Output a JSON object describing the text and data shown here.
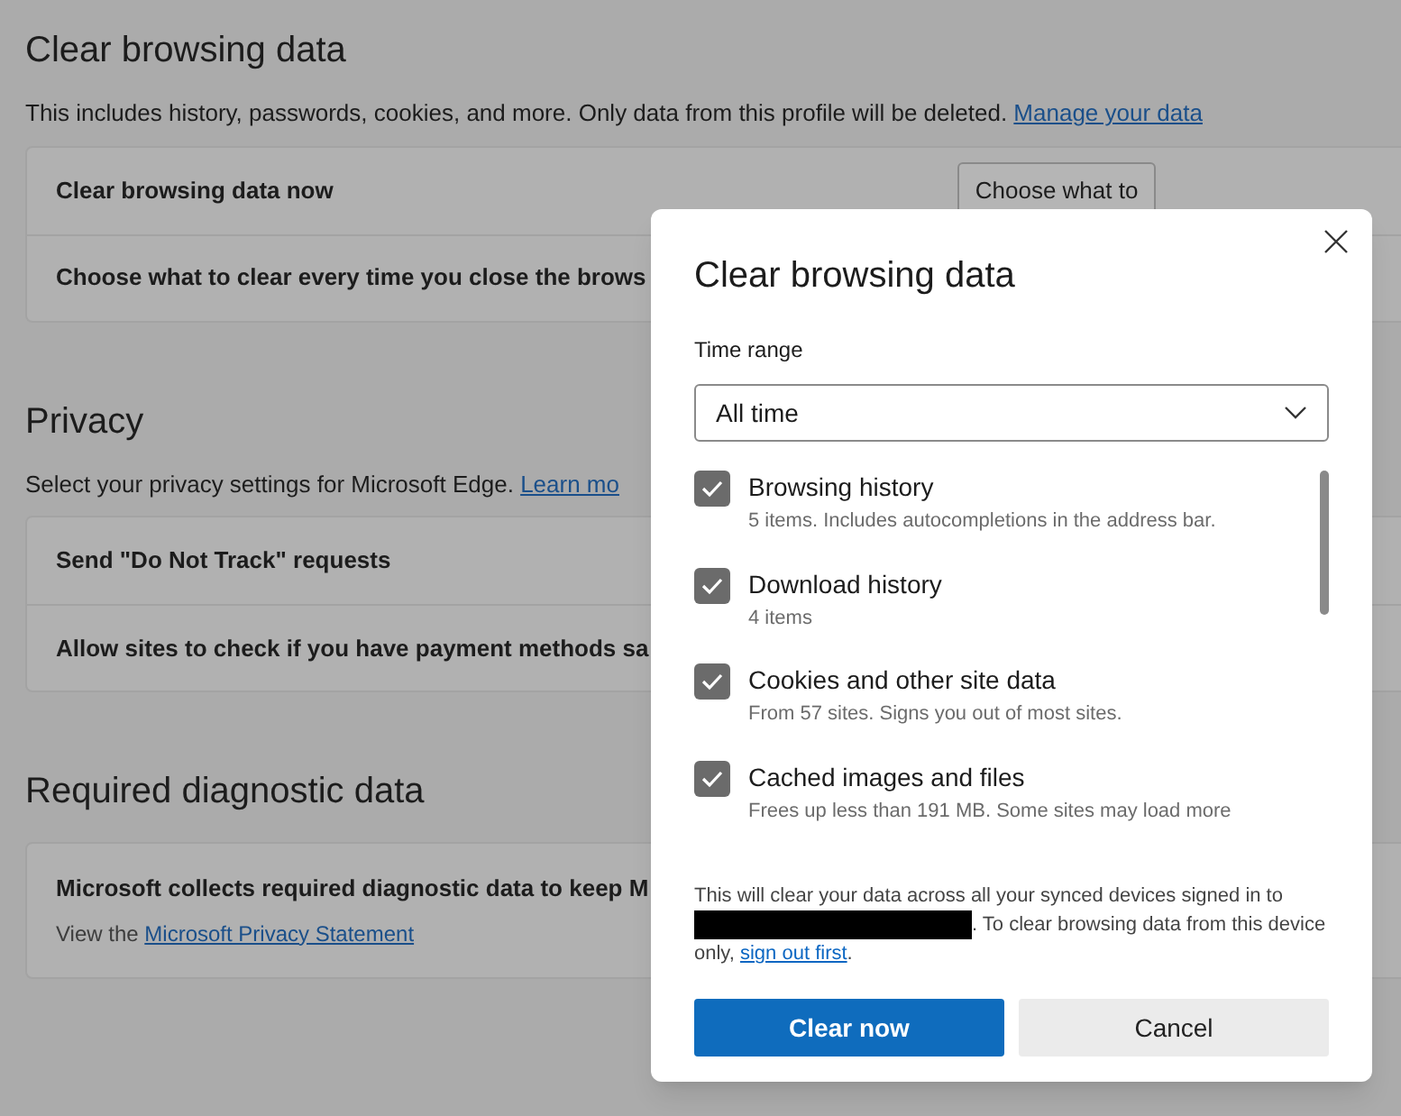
{
  "sections": [
    {
      "title": "Clear browsing data",
      "description": "This includes history, passwords, cookies, and more. Only data from this profile will be deleted. ",
      "link": "Manage your data",
      "rows": [
        {
          "label": "Clear browsing data now",
          "button": "Choose what to"
        },
        {
          "label": "Choose what to clear every time you close the brows"
        }
      ]
    },
    {
      "title": "Privacy",
      "description": "Select your privacy settings for Microsoft Edge. ",
      "link": "Learn mo",
      "rows": [
        {
          "label": "Send \"Do Not Track\" requests"
        },
        {
          "label": "Allow sites to check if you have payment methods sa"
        }
      ]
    },
    {
      "title": "Required diagnostic data",
      "rows": [
        {
          "label": "Microsoft collects required diagnostic data to keep M",
          "detail": "View the ",
          "detail_link": "Microsoft Privacy Statement"
        }
      ]
    }
  ],
  "dialog": {
    "title": "Clear browsing data",
    "time_range_label": "Time range",
    "time_range": "All time",
    "items": [
      {
        "label": "Browsing history",
        "detail": "5 items. Includes autocompletions in the address bar.",
        "checked": true
      },
      {
        "label": "Download history",
        "detail": "4 items",
        "checked": true
      },
      {
        "label": "Cookies and other site data",
        "detail": "From 57 sites. Signs you out of most sites.",
        "checked": true
      },
      {
        "label": "Cached images and files",
        "detail": "Frees up less than 191 MB. Some sites may load more",
        "checked": true
      }
    ],
    "notice_before": "This will clear your data across all your synced devices signed in to ",
    "notice_after": ". To clear browsing data from this device only, ",
    "notice_link": "sign out first",
    "notice_end": ".",
    "primary_button": "Clear now",
    "secondary_button": "Cancel"
  }
}
